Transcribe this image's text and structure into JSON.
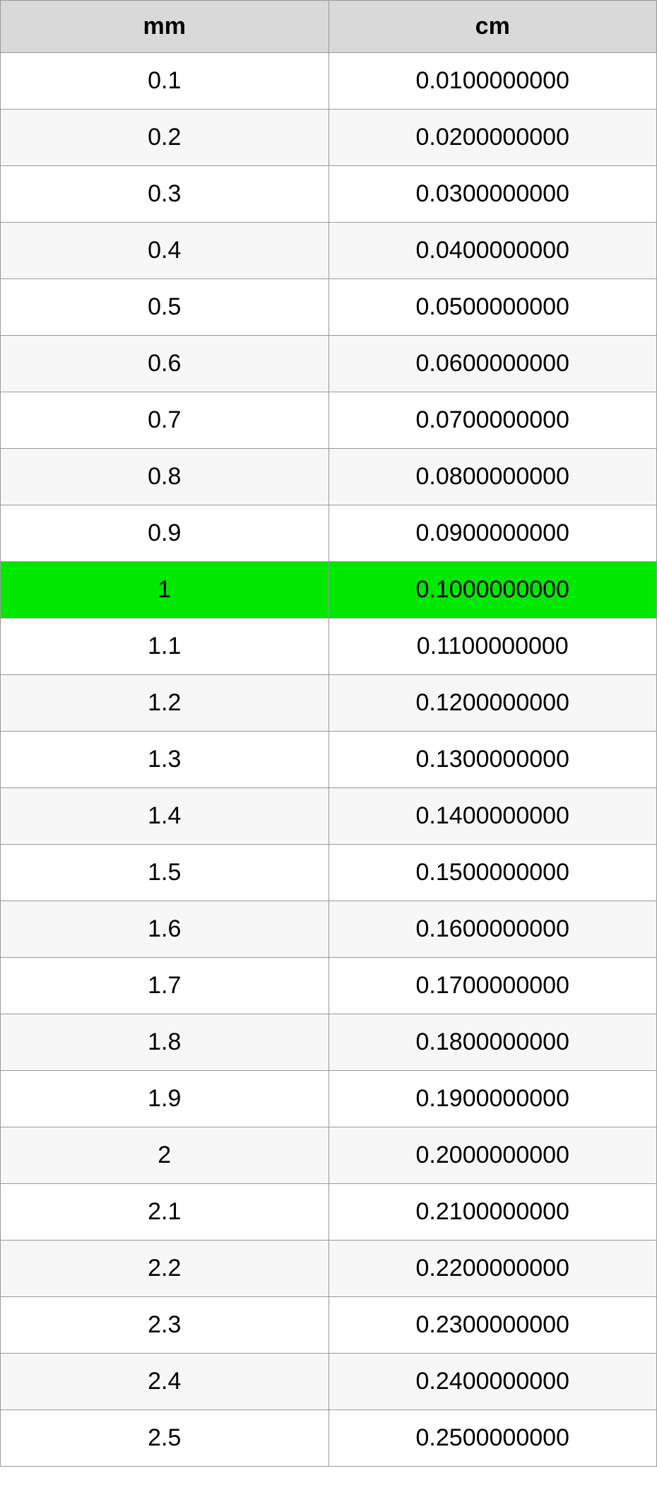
{
  "table": {
    "headers": {
      "col1": "mm",
      "col2": "cm"
    },
    "rows": [
      {
        "mm": "0.1",
        "cm": "0.0100000000",
        "highlight": false
      },
      {
        "mm": "0.2",
        "cm": "0.0200000000",
        "highlight": false
      },
      {
        "mm": "0.3",
        "cm": "0.0300000000",
        "highlight": false
      },
      {
        "mm": "0.4",
        "cm": "0.0400000000",
        "highlight": false
      },
      {
        "mm": "0.5",
        "cm": "0.0500000000",
        "highlight": false
      },
      {
        "mm": "0.6",
        "cm": "0.0600000000",
        "highlight": false
      },
      {
        "mm": "0.7",
        "cm": "0.0700000000",
        "highlight": false
      },
      {
        "mm": "0.8",
        "cm": "0.0800000000",
        "highlight": false
      },
      {
        "mm": "0.9",
        "cm": "0.0900000000",
        "highlight": false
      },
      {
        "mm": "1",
        "cm": "0.1000000000",
        "highlight": true
      },
      {
        "mm": "1.1",
        "cm": "0.1100000000",
        "highlight": false
      },
      {
        "mm": "1.2",
        "cm": "0.1200000000",
        "highlight": false
      },
      {
        "mm": "1.3",
        "cm": "0.1300000000",
        "highlight": false
      },
      {
        "mm": "1.4",
        "cm": "0.1400000000",
        "highlight": false
      },
      {
        "mm": "1.5",
        "cm": "0.1500000000",
        "highlight": false
      },
      {
        "mm": "1.6",
        "cm": "0.1600000000",
        "highlight": false
      },
      {
        "mm": "1.7",
        "cm": "0.1700000000",
        "highlight": false
      },
      {
        "mm": "1.8",
        "cm": "0.1800000000",
        "highlight": false
      },
      {
        "mm": "1.9",
        "cm": "0.1900000000",
        "highlight": false
      },
      {
        "mm": "2",
        "cm": "0.2000000000",
        "highlight": false
      },
      {
        "mm": "2.1",
        "cm": "0.2100000000",
        "highlight": false
      },
      {
        "mm": "2.2",
        "cm": "0.2200000000",
        "highlight": false
      },
      {
        "mm": "2.3",
        "cm": "0.2300000000",
        "highlight": false
      },
      {
        "mm": "2.4",
        "cm": "0.2400000000",
        "highlight": false
      },
      {
        "mm": "2.5",
        "cm": "0.2500000000",
        "highlight": false
      }
    ]
  },
  "colors": {
    "headerBg": "#d9d9d9",
    "altRowBg": "#f7f7f7",
    "highlightBg": "#00e800",
    "border": "#999999"
  }
}
